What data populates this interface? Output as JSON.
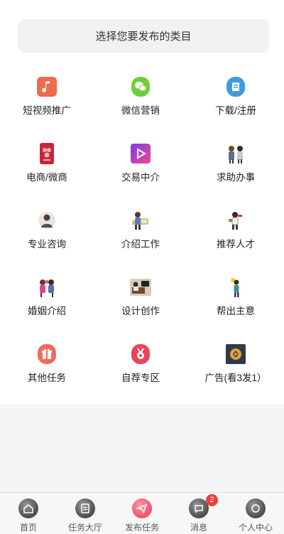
{
  "header": {
    "title": "选择您要发布的类目"
  },
  "categories": [
    {
      "label": "短视频推广",
      "icon": "music-note-icon"
    },
    {
      "label": "微信营销",
      "icon": "wechat-icon"
    },
    {
      "label": "下载/注册",
      "icon": "download-register-icon"
    },
    {
      "label": "电商/微商",
      "icon": "ecommerce-icon"
    },
    {
      "label": "交易中介",
      "icon": "play-trade-icon"
    },
    {
      "label": "求助办事",
      "icon": "help-people-icon"
    },
    {
      "label": "专业咨询",
      "icon": "consultant-icon"
    },
    {
      "label": "介绍工作",
      "icon": "job-intro-icon"
    },
    {
      "label": "推荐人才",
      "icon": "talent-icon"
    },
    {
      "label": "婚姻介绍",
      "icon": "marriage-icon"
    },
    {
      "label": "设计创作",
      "icon": "design-icon"
    },
    {
      "label": "帮出主意",
      "icon": "idea-icon"
    },
    {
      "label": "其他任务",
      "icon": "gift-icon"
    },
    {
      "label": "自荐专区",
      "icon": "medal-icon"
    },
    {
      "label": "广告(看3发1）",
      "icon": "ad-icon"
    }
  ],
  "tabbar": {
    "tabs": [
      {
        "label": "首页",
        "icon": "home-icon"
      },
      {
        "label": "任务大厅",
        "icon": "task-hall-icon"
      },
      {
        "label": "发布任务",
        "icon": "send-icon"
      },
      {
        "label": "消息",
        "icon": "message-icon",
        "badge": "2"
      },
      {
        "label": "个人中心",
        "icon": "profile-icon"
      }
    ]
  }
}
